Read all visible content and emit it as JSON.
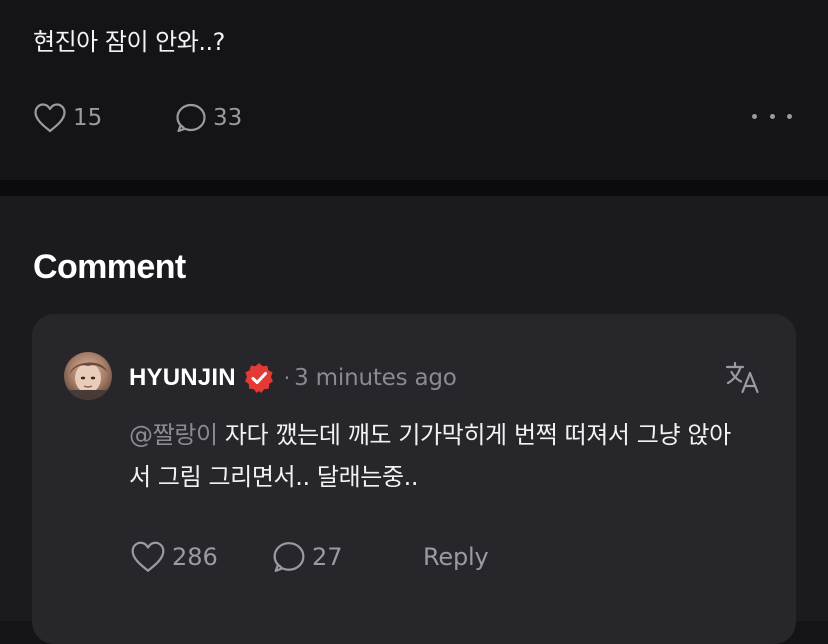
{
  "post": {
    "text": "현진아 잠이 안와..?",
    "like_count": "15",
    "comment_count": "33",
    "icons": {
      "like": "heart-icon",
      "comment": "speech-bubble-icon",
      "more": "more-horizontal-icon"
    }
  },
  "comments_section": {
    "title": "Comment",
    "items": [
      {
        "author": "HYUNJIN",
        "verified_icon": "verified-badge-icon",
        "separator": "·",
        "time": "3 minutes ago",
        "mention": "@짤랑이",
        "text": " 자다 깼는데 깨도 기가막히게 번쩍 떠져서 그냥 앉아서 그림 그리면서.. 달래는중..",
        "like_count": "286",
        "comment_count": "27",
        "reply_label": "Reply",
        "translate_icon": "translate-icon"
      }
    ]
  },
  "colors": {
    "background": "#141417",
    "section_background": "#1b1b1f",
    "card_background": "#26262b",
    "muted_text": "#9a9aa2",
    "verified_badge": "#e53935"
  }
}
